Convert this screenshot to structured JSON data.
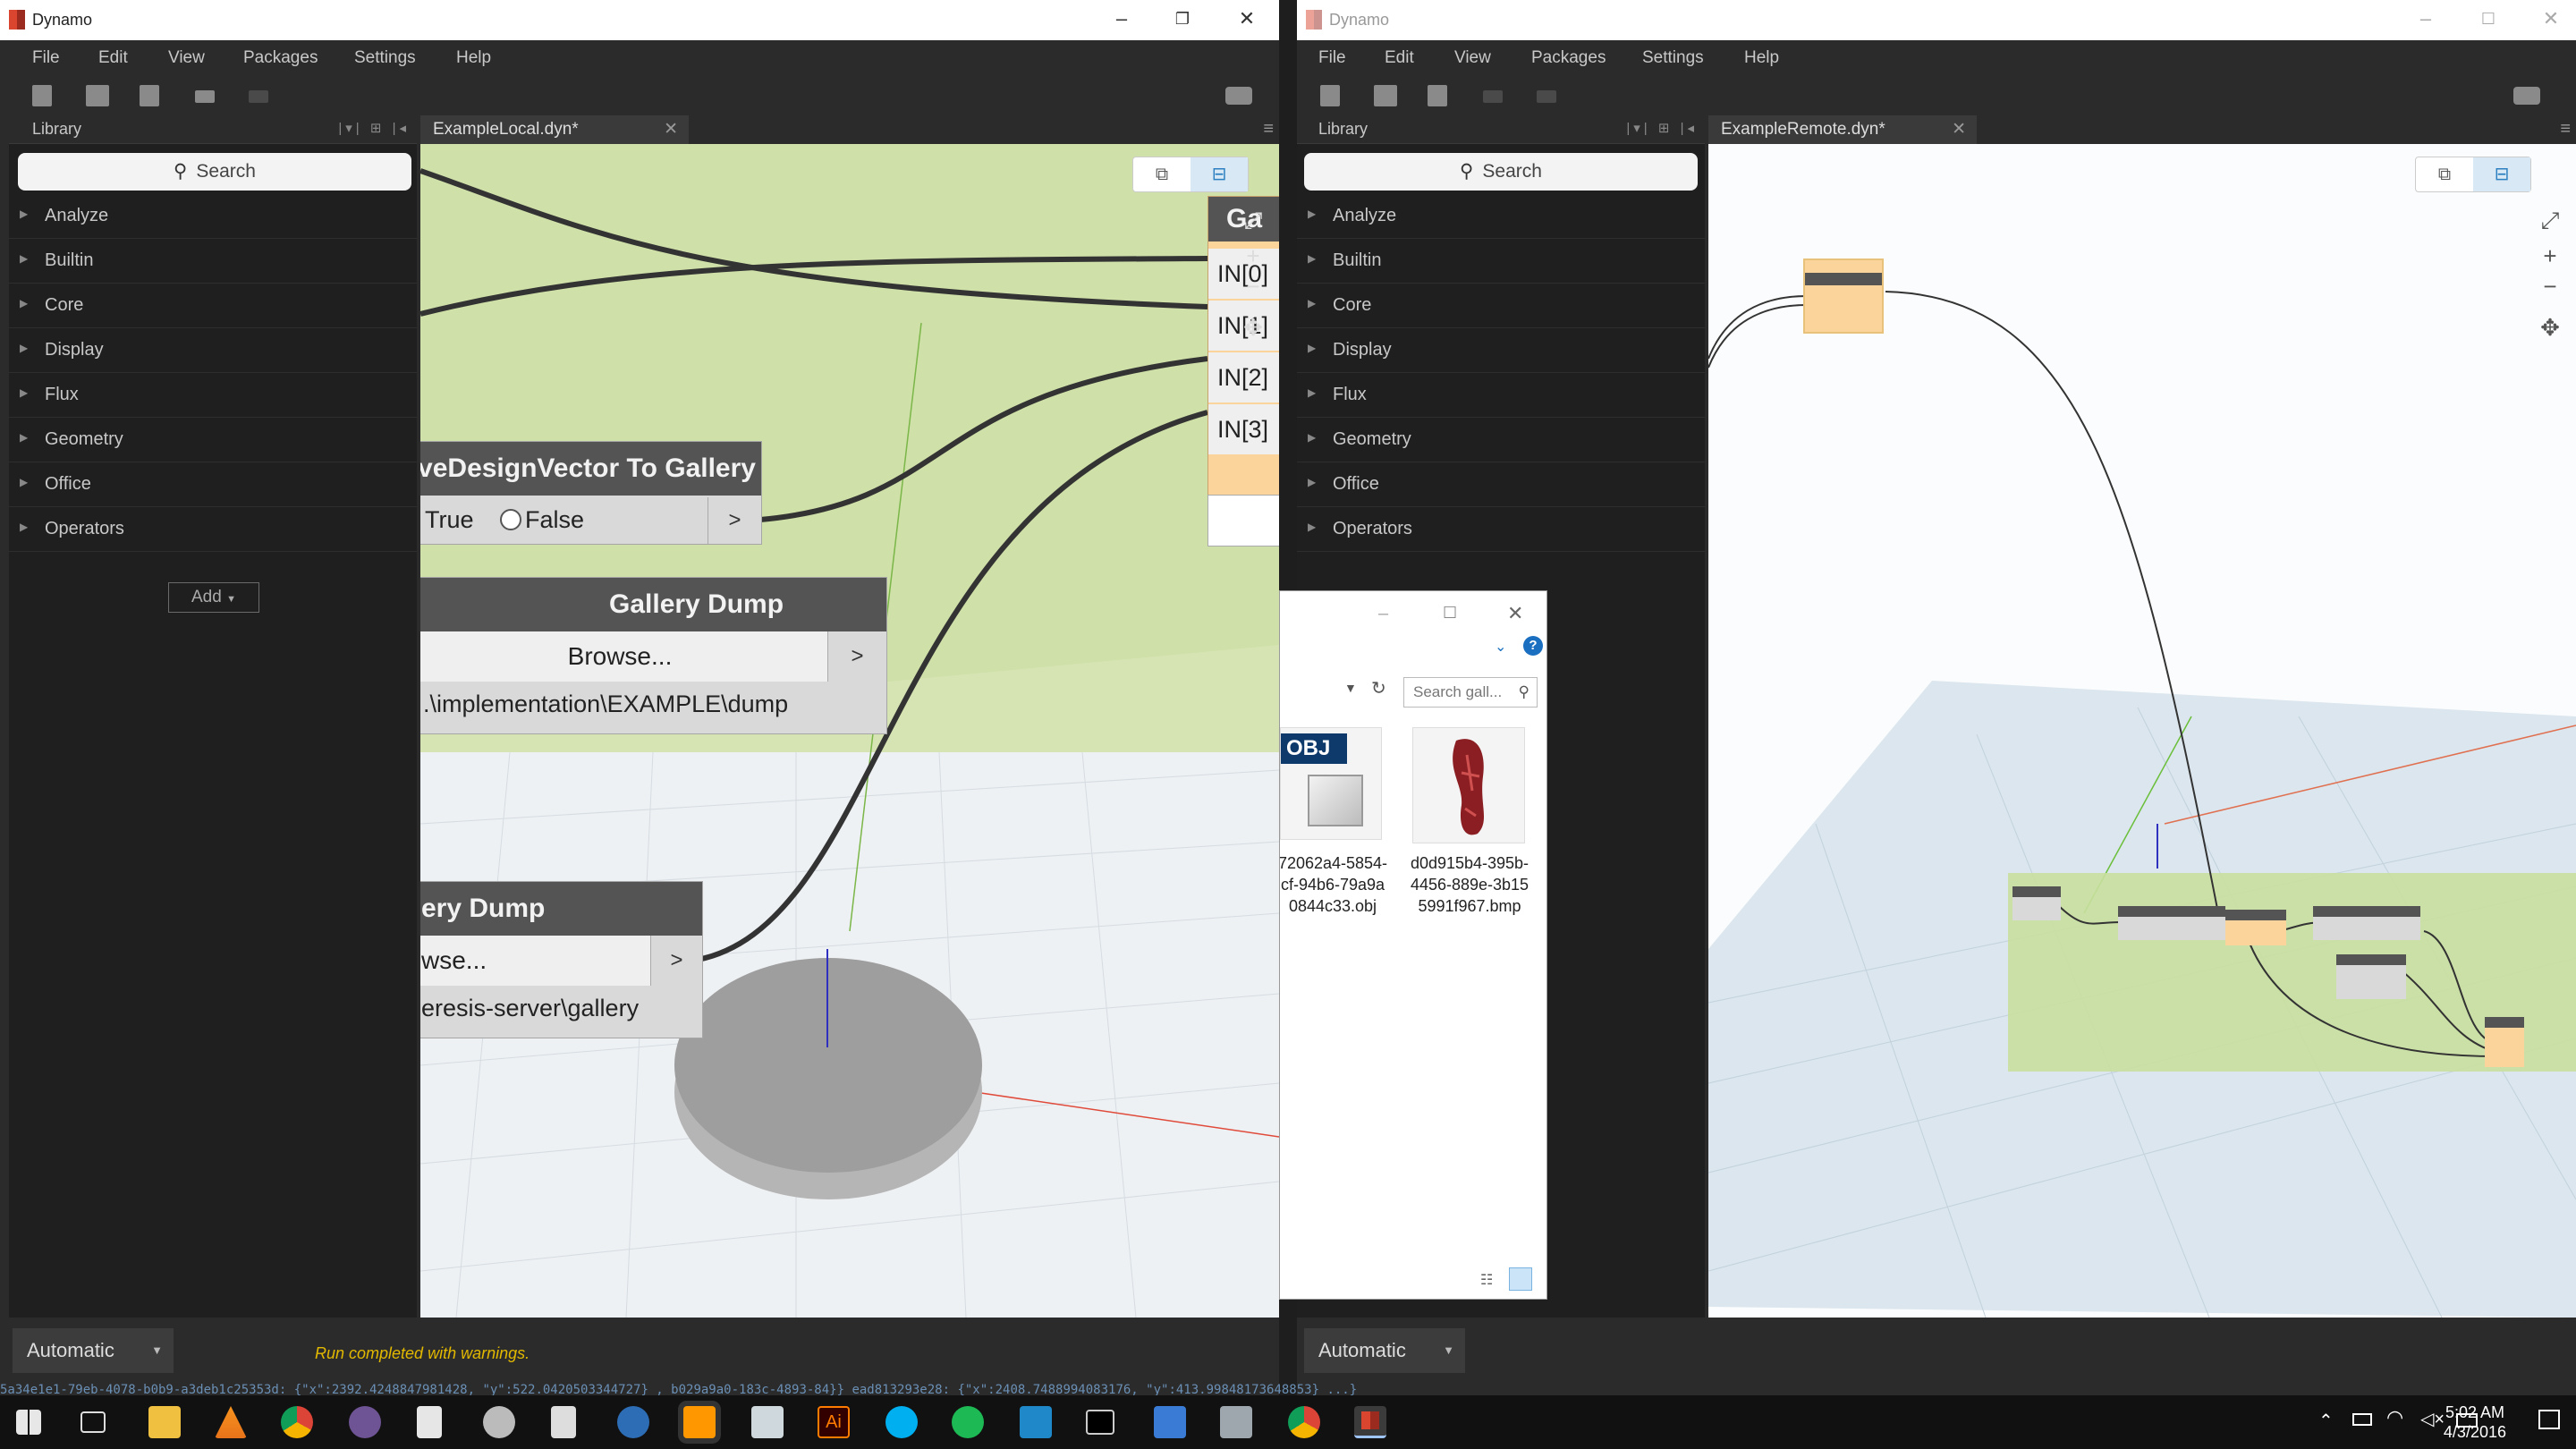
{
  "windows": {
    "left": {
      "title": "Dynamo",
      "menu": [
        "File",
        "Edit",
        "View",
        "Packages",
        "Settings",
        "Help"
      ],
      "library_header": "Library",
      "search_placeholder": "Search",
      "library_items": [
        "Analyze",
        "Builtin",
        "Core",
        "Display",
        "Flux",
        "Geometry",
        "Office",
        "Operators"
      ],
      "add_button": "Add",
      "tab_title": "ExampleLocal.dyn*",
      "run_mode": "Automatic",
      "status_message": "Run completed with warnings."
    },
    "right": {
      "title": "Dynamo",
      "menu": [
        "File",
        "Edit",
        "View",
        "Packages",
        "Settings",
        "Help"
      ],
      "library_header": "Library",
      "search_placeholder": "Search",
      "library_items": [
        "Analyze",
        "Builtin",
        "Core",
        "Display",
        "Flux",
        "Geometry",
        "Office",
        "Operators"
      ],
      "tab_title": "ExampleRemote.dyn*",
      "run_mode": "Automatic"
    }
  },
  "nodes": {
    "save_vector": {
      "title": "veDesignVector To Gallery",
      "true_label": "True",
      "false_label": "False",
      "arrow": ">"
    },
    "gallery_dump_1": {
      "title": "Gallery Dump",
      "browse": "Browse...",
      "arrow": ">",
      "path": ".\\implementation\\EXAMPLE\\dump"
    },
    "gallery_dump_2": {
      "title": "ery Dump",
      "browse": "wse...",
      "arrow": ">",
      "path": "eresis-server\\gallery"
    },
    "ports": [
      "IN[0]",
      "IN[1]",
      "IN[2]",
      "IN[3]"
    ],
    "partial_title": "Ga"
  },
  "explorer": {
    "search_placeholder": "Search gall...",
    "help": "?",
    "files": [
      {
        "badge": "OBJ",
        "name": "72062a4-5854-\ncf-94b6-79a9a\n0844c33.obj"
      },
      {
        "name": "d0d915b4-395b-\n4456-889e-3b15\n5991f967.bmp"
      }
    ]
  },
  "background_text": "5a34e1e1-79eb-4078-b0b9-a3deb1c25353d: {\"x\":2392.4248847981428, \"y\":522.0420503344727} , b029a9a0-183c-4893-84}} ead813293e28: {\"x\":2408.7488994083176, \"y\":413.99848173648853} ...}",
  "taskbar": {
    "time": "5:02 AM",
    "date": "4/3/2016"
  },
  "colors": {
    "accent_orange": "#fbd49b",
    "node_header": "#545454",
    "group_green": "#c9df9e",
    "warning": "#e3b900"
  }
}
